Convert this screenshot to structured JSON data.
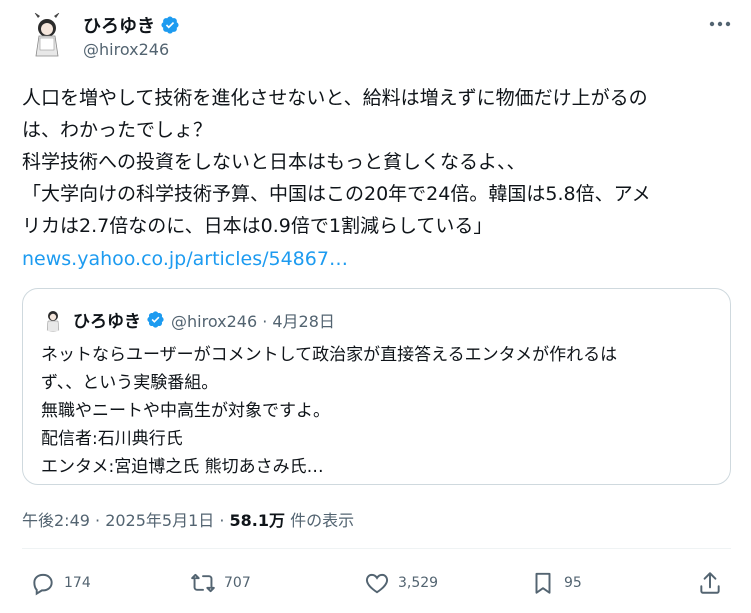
{
  "author": {
    "name": "ひろゆき",
    "handle": "@hirox246"
  },
  "tweet": {
    "lines": [
      "人口を増やして技術を進化させないと、給料は増えずに物価だけ上がるの",
      "は、わかったでしょ？",
      "科学技術への投資をしないと日本はもっと貧しくなるよ、、",
      "「大学向けの科学技術予算、中国はこの20年で24倍。韓国は5.8倍、アメ",
      "リカは2.7倍なのに、日本は0.9倍で1割減らしている」"
    ],
    "link": "news.yahoo.co.jp/articles/54867…"
  },
  "quote": {
    "name": "ひろゆき",
    "meta": "@hirox246 · 4月28日",
    "lines": [
      "ネットならユーザーがコメントして政治家が直接答えるエンタメが作れるは",
      "ず、、という実験番組。",
      "無職やニートや中高生が対象ですよ。",
      "配信者:石川典行氏",
      "エンタメ:宮迫博之氏 熊切あさみ氏…"
    ]
  },
  "meta": {
    "time": "午後2:49 · 2025年5月1日 · ",
    "views_count": "58.1万",
    "views_label": " 件の表示"
  },
  "actions": {
    "replies": "174",
    "reposts": "707",
    "likes": "3,529",
    "bookmarks": "95"
  },
  "icons": {
    "verified": "verified-badge-icon",
    "more": "more-icon",
    "reply": "reply-icon",
    "repost": "repost-icon",
    "like": "like-icon",
    "bookmark": "bookmark-icon",
    "share": "share-icon"
  },
  "colors": {
    "accent": "#1d9bf0",
    "secondary_text": "#536471",
    "border": "#cfd9de"
  }
}
